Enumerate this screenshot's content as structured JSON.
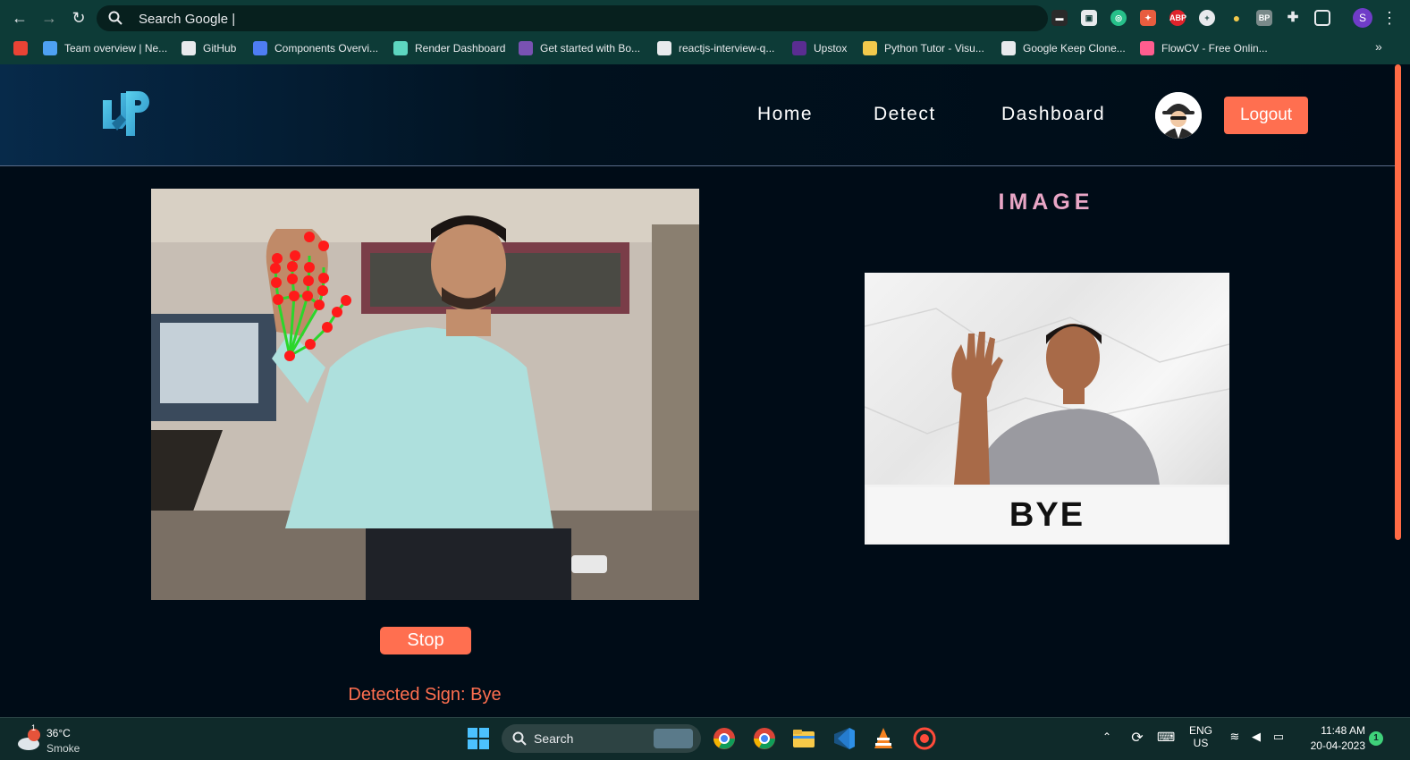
{
  "browser": {
    "omnibox_placeholder": "Search Google |",
    "profile_initial": "S",
    "bookmarks": [
      {
        "label": "",
        "icon": "gmail-icon",
        "color": "#ea4335"
      },
      {
        "label": "Team overview | Ne...",
        "icon": "diamond-icon",
        "color": "#4ea1f3"
      },
      {
        "label": "GitHub",
        "icon": "github-icon",
        "color": "#e8eaed"
      },
      {
        "label": "Components Overvi...",
        "icon": "component-icon",
        "color": "#4e7df3"
      },
      {
        "label": "Render Dashboard",
        "icon": "render-icon",
        "color": "#5dd6c0"
      },
      {
        "label": "Get started with Bo...",
        "icon": "bootstrap-icon",
        "color": "#7952b3"
      },
      {
        "label": "reactjs-interview-q...",
        "icon": "github-icon",
        "color": "#e8eaed"
      },
      {
        "label": "Upstox",
        "icon": "upstox-icon",
        "color": "#5a2d91"
      },
      {
        "label": "Python Tutor - Visu...",
        "icon": "python-icon",
        "color": "#f2c94c"
      },
      {
        "label": "Google Keep Clone...",
        "icon": "keep-icon",
        "color": "#e8eaed"
      },
      {
        "label": "FlowCV - Free Onlin...",
        "icon": "flowcv-icon",
        "color": "#ff5d8f"
      }
    ],
    "more_label": "»"
  },
  "site": {
    "nav": {
      "home": "Home",
      "detect": "Detect",
      "dashboard": "Dashboard",
      "logout": "Logout"
    },
    "webcam": {
      "stop_label": "Stop",
      "detected_text": "Detected Sign: Bye"
    },
    "reference": {
      "title": "IMAGE",
      "sign_label": "BYE"
    },
    "colors": {
      "accent": "#ff6f50",
      "title_pink": "#e9a6c6",
      "background": "#000c17"
    }
  },
  "taskbar": {
    "weather_temp": "36°C",
    "weather_desc": "Smoke",
    "weather_badge": "1",
    "search_label": "Search",
    "lang_top": "ENG",
    "lang_bottom": "US",
    "time": "11:48 AM",
    "date": "20-04-2023",
    "notification_count": "1"
  }
}
